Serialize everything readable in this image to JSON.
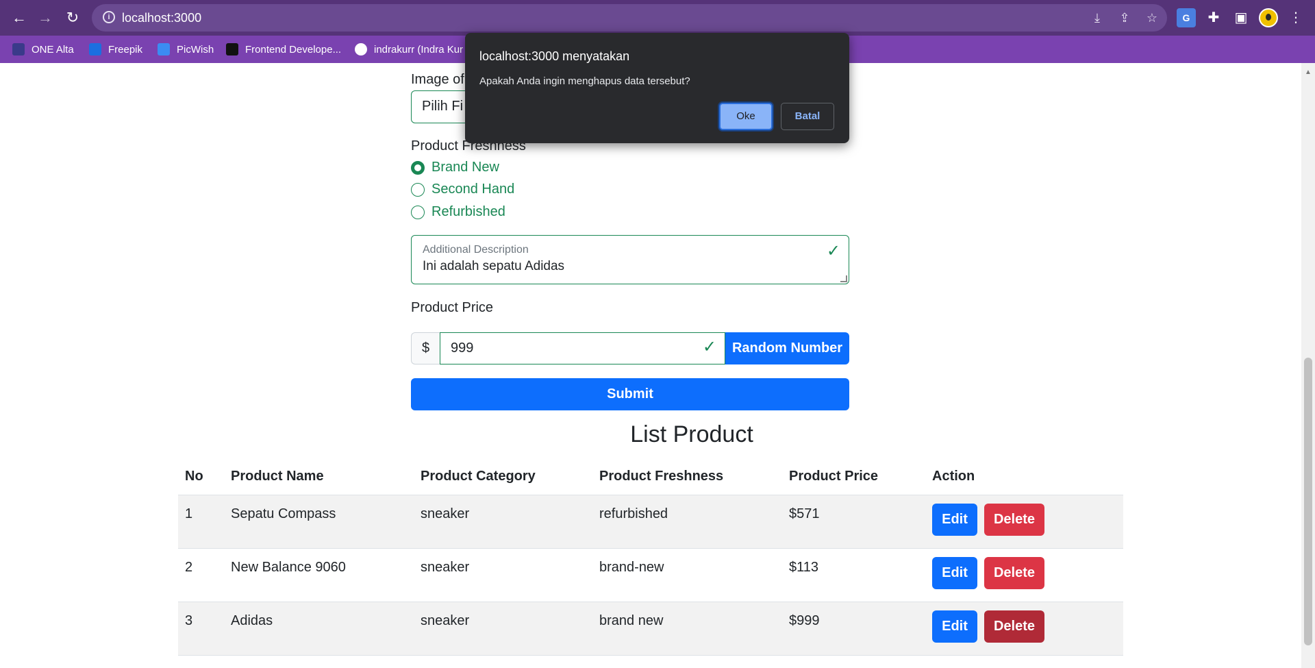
{
  "browser": {
    "url": "localhost:3000",
    "bookmarks": [
      {
        "label": "ONE Alta"
      },
      {
        "label": "Freepik"
      },
      {
        "label": "PicWish"
      },
      {
        "label": "Frontend Develope..."
      },
      {
        "label": "indrakurr (Indra Kur"
      }
    ]
  },
  "form": {
    "image_label": "Image of",
    "file_input_text": "Pilih Fi",
    "freshness_label": "Product Freshness",
    "freshness_options": [
      {
        "label": "Brand New",
        "checked": true
      },
      {
        "label": "Second Hand",
        "checked": false
      },
      {
        "label": "Refurbished",
        "checked": false
      }
    ],
    "description_label": "Additional Description",
    "description_value": "Ini adalah sepatu Adidas",
    "price_label": "Product Price",
    "price_prefix": "$",
    "price_value": "999",
    "random_button": "Random Number",
    "submit_button": "Submit"
  },
  "list": {
    "title": "List Product",
    "headers": [
      "No",
      "Product Name",
      "Product Category",
      "Product Freshness",
      "Product Price",
      "Action"
    ],
    "rows": [
      {
        "no": "1",
        "name": "Sepatu Compass",
        "category": "sneaker",
        "freshness": "refurbished",
        "price": "$571"
      },
      {
        "no": "2",
        "name": "New Balance 9060",
        "category": "sneaker",
        "freshness": "brand-new",
        "price": "$113"
      },
      {
        "no": "3",
        "name": "Adidas",
        "category": "sneaker",
        "freshness": "brand new",
        "price": "$999"
      }
    ],
    "edit_label": "Edit",
    "delete_label": "Delete"
  },
  "dialog": {
    "title": "localhost:3000 menyatakan",
    "message": "Apakah Anda ingin menghapus data tersebut?",
    "ok_label": "Oke",
    "cancel_label": "Batal"
  },
  "colors": {
    "success": "#198754",
    "primary": "#0d6efd",
    "danger": "#dc3545",
    "chrome_top": "#553378",
    "chrome_bookmarks": "#7a42b0"
  }
}
